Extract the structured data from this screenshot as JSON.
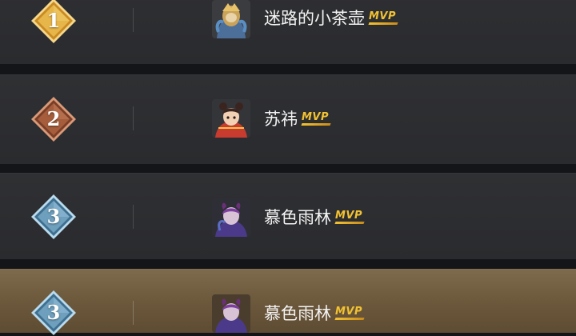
{
  "rows": [
    {
      "rank": "1",
      "name": "迷路的小茶壶",
      "mvp": "MVP",
      "badge_colors": [
        "#e7b64a",
        "#c98a22",
        "#f6d88a"
      ],
      "avatar": "hero-gold-masked-icon"
    },
    {
      "rank": "2",
      "name": "苏祎",
      "mvp": "MVP",
      "badge_colors": [
        "#b4714f",
        "#7a3d27",
        "#d99a78"
      ],
      "avatar": "hero-red-girl-icon"
    },
    {
      "rank": "3",
      "name": "慕色雨林",
      "mvp": "MVP",
      "badge_colors": [
        "#7fb2cf",
        "#3f6f8f",
        "#b9dbee"
      ],
      "avatar": "hero-purple-horned-icon"
    },
    {
      "rank": "3",
      "name": "慕色雨林",
      "mvp": "MVP",
      "badge_colors": [
        "#7fb2cf",
        "#3f6f8f",
        "#b9dbee"
      ],
      "avatar": "hero-purple-horned-icon"
    }
  ]
}
